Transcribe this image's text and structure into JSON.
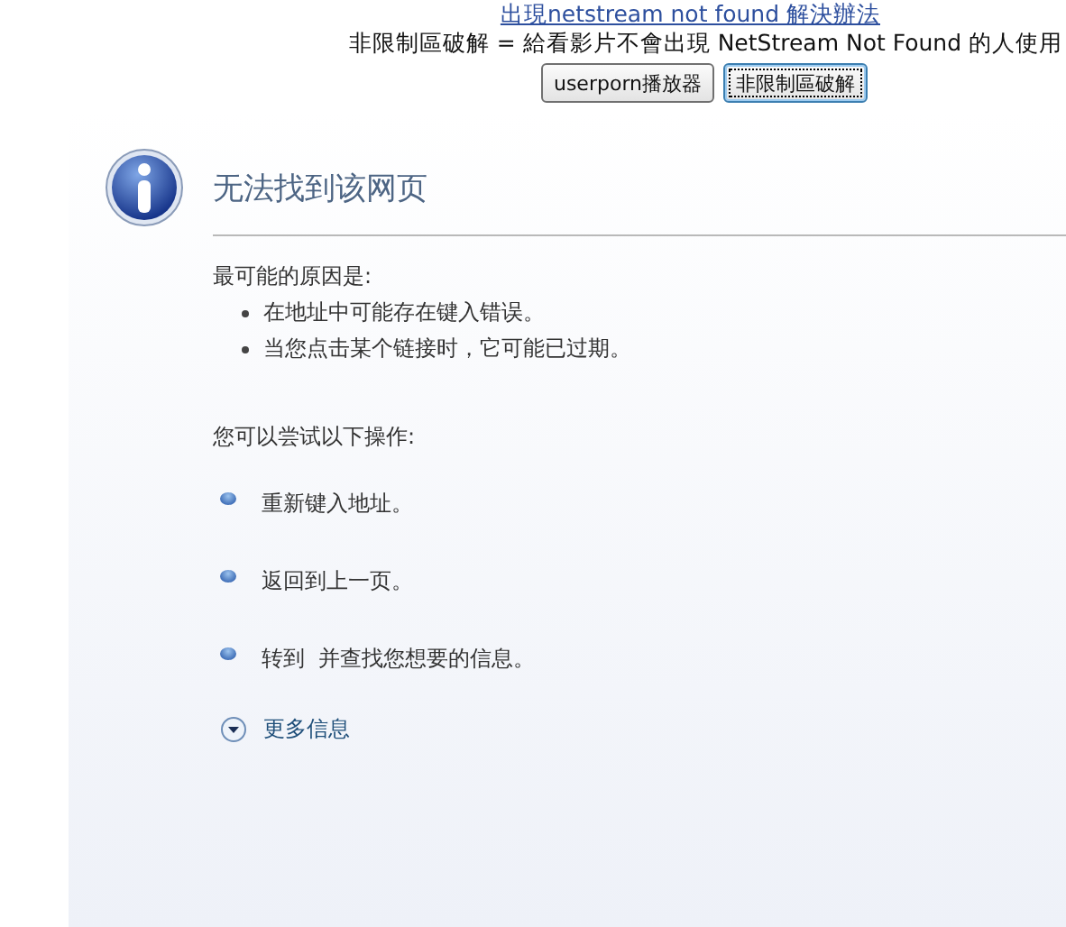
{
  "header": {
    "link": "出現netstream not found 解決辦法",
    "note": "非限制區破解 = 給看影片不會出現 NetStream Not Found 的人使用",
    "buttons": [
      {
        "label": "userporn播放器",
        "focused": false
      },
      {
        "label": "非限制區破解",
        "focused": true
      }
    ]
  },
  "error_page": {
    "title": "无法找到该网页",
    "causes_heading": "最可能的原因是:",
    "causes": [
      "在地址中可能存在键入错误。",
      "当您点击某个链接时，它可能已过期。"
    ],
    "actions_heading": "您可以尝试以下操作:",
    "actions": [
      "重新键入地址。",
      "返回到上一页。",
      "转到  并查找您想要的信息。"
    ],
    "more_info": "更多信息"
  }
}
